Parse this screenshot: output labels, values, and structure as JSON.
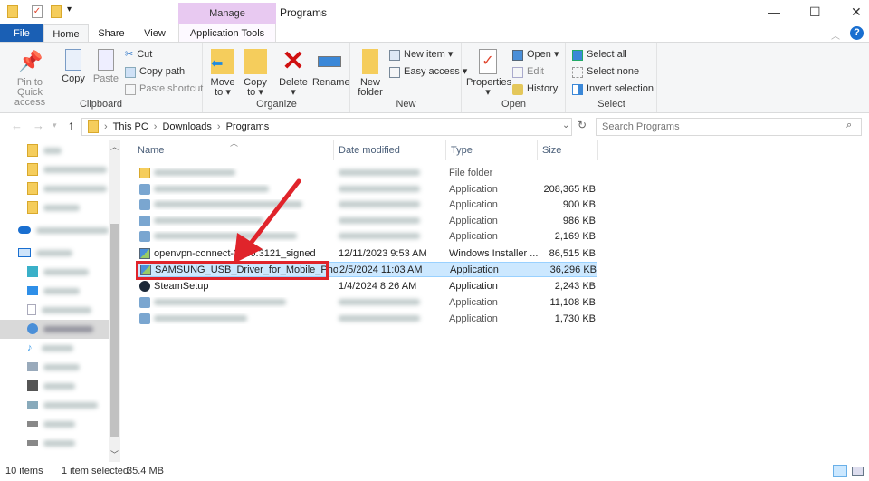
{
  "window": {
    "title": "Programs",
    "context_tab": "Manage",
    "minimize": "—",
    "maximize": "☐",
    "close": "✕",
    "help": "?"
  },
  "tabs": {
    "file": "File",
    "home": "Home",
    "share": "Share",
    "view": "View",
    "app_tools": "Application Tools"
  },
  "ribbon": {
    "clipboard": {
      "label": "Clipboard",
      "pin": "Pin to Quick access",
      "copy": "Copy",
      "paste": "Paste",
      "cut": "Cut",
      "copy_path": "Copy path",
      "paste_shortcut": "Paste shortcut"
    },
    "organize": {
      "label": "Organize",
      "move_to": "Move to ▾",
      "copy_to": "Copy to ▾",
      "delete": "Delete ▾",
      "rename": "Rename"
    },
    "new": {
      "label": "New",
      "new_folder": "New folder",
      "new_item": "New item ▾",
      "easy_access": "Easy access ▾"
    },
    "open": {
      "label": "Open",
      "properties": "Properties ▾",
      "open": "Open ▾",
      "edit": "Edit",
      "history": "History"
    },
    "select": {
      "label": "Select",
      "select_all": "Select all",
      "select_none": "Select none",
      "invert": "Invert selection"
    }
  },
  "address": {
    "crumbs": [
      "This PC",
      "Downloads",
      "Programs"
    ],
    "search_placeholder": "Search Programs"
  },
  "columns": {
    "name": "Name",
    "date": "Date modified",
    "type": "Type",
    "size": "Size"
  },
  "files": [
    {
      "name": "",
      "date": "",
      "type": "File folder",
      "size": "",
      "icon": "folder",
      "blurred": true
    },
    {
      "name": "",
      "date": "",
      "type": "Application",
      "size": "208,365 KB",
      "icon": "app",
      "blurred": true
    },
    {
      "name": "",
      "date": "",
      "type": "Application",
      "size": "900 KB",
      "icon": "app",
      "blurred": true
    },
    {
      "name": "",
      "date": "",
      "type": "Application",
      "size": "986 KB",
      "icon": "app",
      "blurred": true
    },
    {
      "name": "",
      "date": "",
      "type": "Application",
      "size": "2,169 KB",
      "icon": "app",
      "blurred": true
    },
    {
      "name": "openvpn-connect-3.4.0.3121_signed",
      "date": "12/11/2023 9:53 AM",
      "type": "Windows Installer ...",
      "size": "86,515 KB",
      "icon": "installer"
    },
    {
      "name": "SAMSUNG_USB_Driver_for_Mobile_Phones",
      "date": "2/5/2024 11:03 AM",
      "type": "Application",
      "size": "36,296 KB",
      "icon": "installer",
      "selected": true
    },
    {
      "name": "SteamSetup",
      "date": "1/4/2024 8:26 AM",
      "type": "Application",
      "size": "2,243 KB",
      "icon": "steam"
    },
    {
      "name": "",
      "date": "",
      "type": "Application",
      "size": "11,108 KB",
      "icon": "app",
      "blurred": true
    },
    {
      "name": "",
      "date": "",
      "type": "Application",
      "size": "1,730 KB",
      "icon": "app",
      "blurred": true
    }
  ],
  "status": {
    "count": "10 items",
    "selected": "1 item selected",
    "size": "35.4 MB"
  },
  "colors": {
    "accent": "#1a5fb4",
    "selection": "#cce8ff",
    "highlight": "#e0242b",
    "manage": "#e8c9f1"
  }
}
